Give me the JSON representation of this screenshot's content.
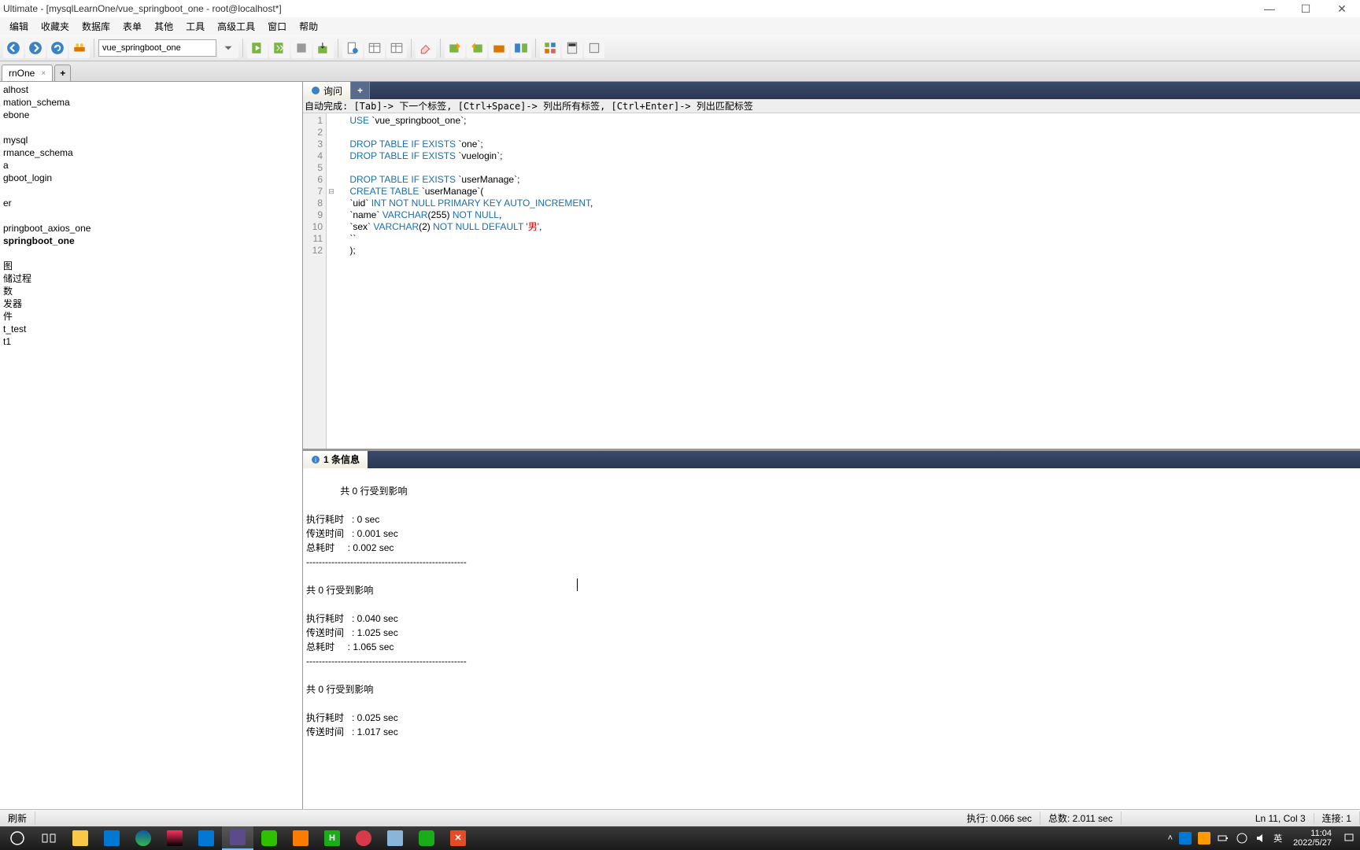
{
  "title": "Ultimate - [mysqlLearnOne/vue_springboot_one - root@localhost*]",
  "window_controls": {
    "min": "—",
    "max": "☐",
    "close": "✕"
  },
  "menu": [
    "编辑",
    "收藏夹",
    "数据库",
    "表单",
    "其他",
    "工具",
    "高级工具",
    "窗口",
    "帮助"
  ],
  "db_select_value": "vue_springboot_one",
  "filetab": {
    "name": "rnOne",
    "close": "×",
    "plus": "+"
  },
  "sidebar": {
    "nodes": [
      {
        "text": "alhost",
        "bold": false
      },
      {
        "text": "mation_schema",
        "bold": false
      },
      {
        "text": "ebone",
        "bold": false
      },
      {
        "text": "",
        "bold": false
      },
      {
        "text": "mysql",
        "bold": false
      },
      {
        "text": "rmance_schema",
        "bold": false
      },
      {
        "text": "a",
        "bold": false
      },
      {
        "text": "gboot_login",
        "bold": false
      },
      {
        "text": "",
        "bold": false
      },
      {
        "text": "er",
        "bold": false
      },
      {
        "text": "",
        "bold": false
      },
      {
        "text": "pringboot_axios_one",
        "bold": false
      },
      {
        "text": "springboot_one",
        "bold": true
      },
      {
        "text": "",
        "bold": false
      },
      {
        "text": "图",
        "bold": false
      },
      {
        "text": "储过程",
        "bold": false
      },
      {
        "text": "数",
        "bold": false
      },
      {
        "text": "发器",
        "bold": false
      },
      {
        "text": "件",
        "bold": false
      },
      {
        "text": "t_test",
        "bold": false
      },
      {
        "text": "t1",
        "bold": false
      }
    ]
  },
  "query_tab": "询问",
  "query_plus": "+",
  "hint": "自动完成:  [Tab]-> 下一个标签,  [Ctrl+Space]-> 列出所有标签,  [Ctrl+Enter]-> 列出匹配标签",
  "code_lines": [
    {
      "n": 1,
      "tokens": [
        {
          "t": "USE",
          "c": "kw"
        },
        {
          "t": " `vue_springboot_one`;",
          "c": ""
        }
      ]
    },
    {
      "n": 2,
      "tokens": [
        {
          "t": "",
          "c": ""
        }
      ]
    },
    {
      "n": 3,
      "tokens": [
        {
          "t": "DROP TABLE IF EXISTS",
          "c": "kw"
        },
        {
          "t": " `one`;",
          "c": ""
        }
      ]
    },
    {
      "n": 4,
      "tokens": [
        {
          "t": "DROP TABLE IF EXISTS",
          "c": "kw"
        },
        {
          "t": " `vuelogin`;",
          "c": ""
        }
      ]
    },
    {
      "n": 5,
      "tokens": [
        {
          "t": "",
          "c": ""
        }
      ]
    },
    {
      "n": 6,
      "tokens": [
        {
          "t": "DROP TABLE IF EXISTS",
          "c": "kw"
        },
        {
          "t": " `userManage`;",
          "c": ""
        }
      ]
    },
    {
      "n": 7,
      "tokens": [
        {
          "t": "CREATE TABLE",
          "c": "kw"
        },
        {
          "t": " `userManage`(",
          "c": ""
        }
      ],
      "fold": "⊟"
    },
    {
      "n": 8,
      "tokens": [
        {
          "t": "`uid` ",
          "c": ""
        },
        {
          "t": "INT NOT NULL PRIMARY KEY AUTO_INCREMENT",
          "c": "kw"
        },
        {
          "t": ",",
          "c": ""
        }
      ]
    },
    {
      "n": 9,
      "tokens": [
        {
          "t": "`name` ",
          "c": ""
        },
        {
          "t": "VARCHAR",
          "c": "kw"
        },
        {
          "t": "(255) ",
          "c": ""
        },
        {
          "t": "NOT NULL",
          "c": "kw"
        },
        {
          "t": ",",
          "c": ""
        }
      ]
    },
    {
      "n": 10,
      "tokens": [
        {
          "t": "`sex` ",
          "c": ""
        },
        {
          "t": "VARCHAR",
          "c": "kw"
        },
        {
          "t": "(2) ",
          "c": ""
        },
        {
          "t": "NOT NULL DEFAULT",
          "c": "kw"
        },
        {
          "t": " ",
          "c": ""
        },
        {
          "t": "'男'",
          "c": "str"
        },
        {
          "t": ",",
          "c": ""
        }
      ]
    },
    {
      "n": 11,
      "tokens": [
        {
          "t": "``",
          "c": ""
        }
      ]
    },
    {
      "n": 12,
      "tokens": [
        {
          "t": ");",
          "c": ""
        }
      ]
    }
  ],
  "messages_tab": "1 条信息",
  "messages_text": "共 0 行受到影响\n\n执行耗时   : 0 sec\n传送时间   : 0.001 sec\n总耗时     : 0.002 sec\n---------------------------------------------------\n\n共 0 行受到影响\n\n执行耗时   : 0.040 sec\n传送时间   : 1.025 sec\n总耗时     : 1.065 sec\n---------------------------------------------------\n\n共 0 行受到影响\n\n执行耗时   : 0.025 sec\n传送时间   : 1.017 sec",
  "status": {
    "left": "刷新",
    "exec": "执行: 0.066 sec",
    "total": "总数: 2.011 sec",
    "pos": "Ln 11, Col 3",
    "conn": "连接: 1"
  },
  "taskbar": {
    "clock_time": "11:04",
    "clock_date": "2022/5/27",
    "ime": "英"
  },
  "toolbar_icons": [
    "nav-back",
    "nav-forward",
    "refresh",
    "connection",
    "db",
    "execute-query",
    "execute-all",
    "stop",
    "export",
    "format",
    "sep",
    "new-query",
    "open-query",
    "save-query",
    "sep",
    "cut-icon",
    "copy-icon",
    "paste-icon",
    "sep",
    "table-icon",
    "result-icon",
    "sep",
    "autocomplete-icon",
    "info-icon"
  ]
}
